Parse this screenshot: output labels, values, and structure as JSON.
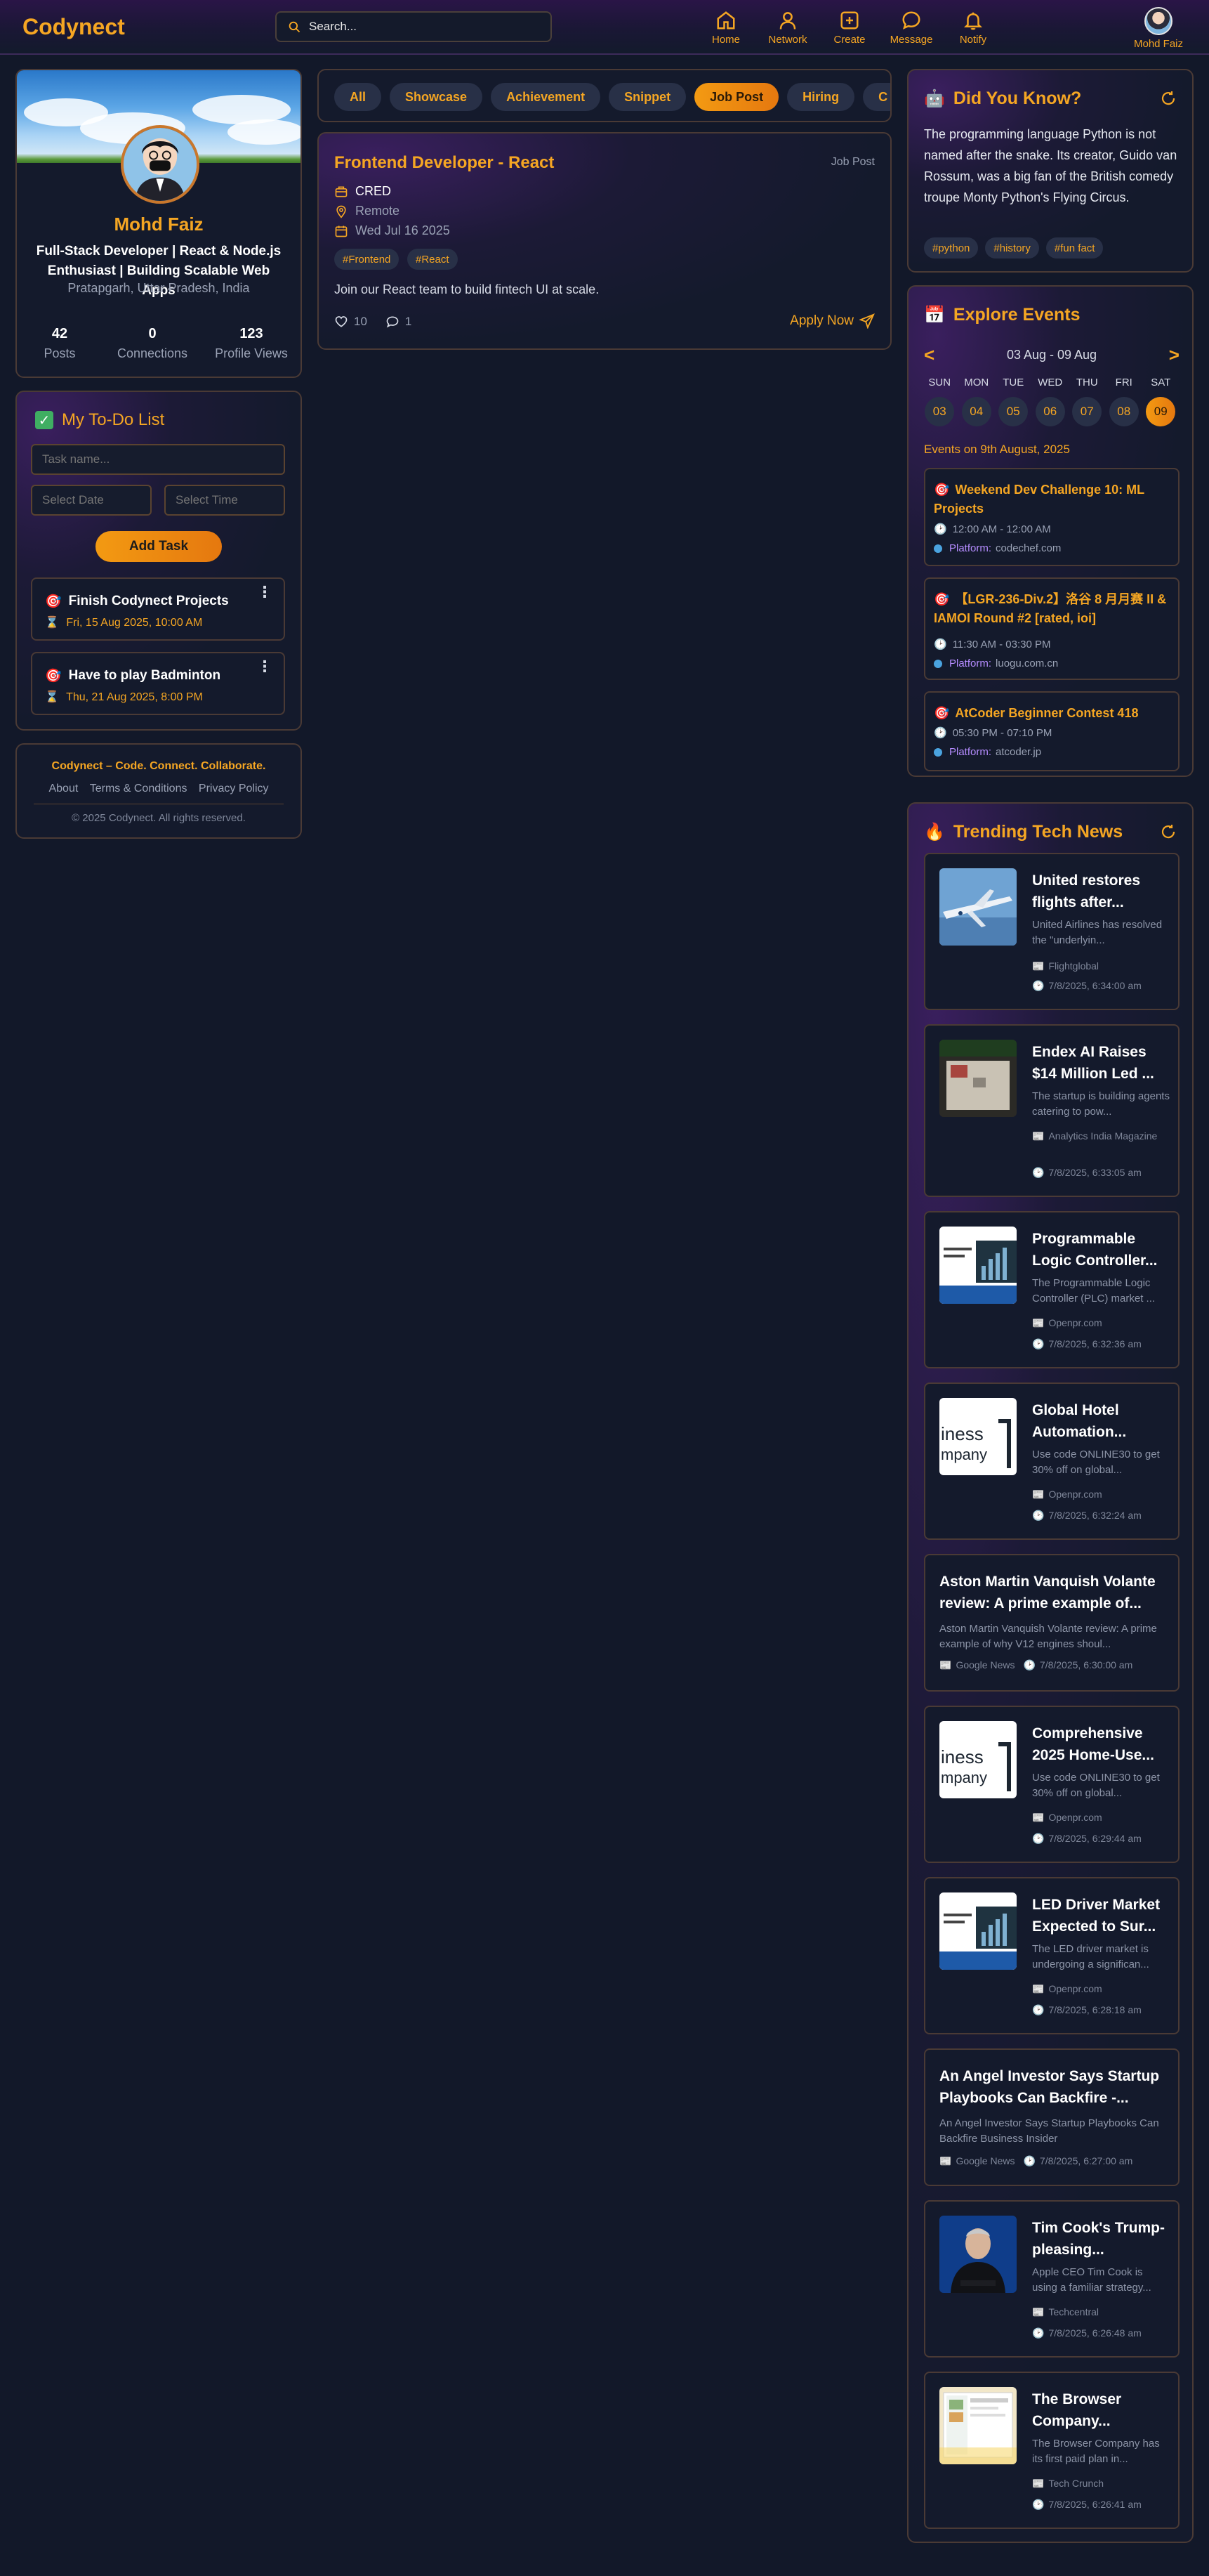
{
  "nav": {
    "brand": "Codynect",
    "search_placeholder": "Search...",
    "items": [
      {
        "label": "Home",
        "icon": "home-icon"
      },
      {
        "label": "Network",
        "icon": "user-icon"
      },
      {
        "label": "Create",
        "icon": "plus-square-icon"
      },
      {
        "label": "Message",
        "icon": "message-icon"
      },
      {
        "label": "Notify",
        "icon": "bell-icon"
      }
    ],
    "profile_label": "Mohd Faiz"
  },
  "profile": {
    "name": "Mohd Faiz",
    "bio": "Full-Stack Developer | React & Node.js Enthusiast | Building Scalable Web Apps",
    "location": "Pratapgarh, Uttar Pradesh, India",
    "stats": [
      {
        "value": "42",
        "label": "Posts"
      },
      {
        "value": "0",
        "label": "Connections"
      },
      {
        "value": "123",
        "label": "Profile Views"
      }
    ]
  },
  "todo": {
    "title": "My To-Do List",
    "task_placeholder": "Task name...",
    "date_placeholder": "Select Date",
    "time_placeholder": "Select Time",
    "add_label": "Add Task",
    "tasks": [
      {
        "title": "Finish Codynect Projects",
        "due": "Fri, 15 Aug 2025, 10:00 AM"
      },
      {
        "title": "Have to play Badminton",
        "due": "Thu, 21 Aug 2025, 8:00 PM"
      }
    ]
  },
  "footer": {
    "tagline": "Codynect – Code. Connect. Collaborate.",
    "links": [
      "About",
      "Terms & Conditions",
      "Privacy Policy"
    ],
    "copyright": "© 2025 Codynect. All rights reserved."
  },
  "filters": {
    "chips": [
      "All",
      "Showcase",
      "Achievement",
      "Snippet",
      "Job Post",
      "Hiring",
      "C"
    ],
    "active": "Job Post"
  },
  "post": {
    "title": "Frontend Developer - React",
    "type": "Job Post",
    "company": "CRED",
    "location": "Remote",
    "date": "Wed Jul 16 2025",
    "tags": [
      "#Frontend",
      "#React"
    ],
    "body": "Join our React team to build fintech UI at scale.",
    "likes": "10",
    "comments": "1",
    "apply_label": "Apply Now"
  },
  "dyk": {
    "title": "Did You Know?",
    "text": "The programming language Python is not named after the snake. Its creator, Guido van Rossum, was a big fan of the British comedy troupe Monty Python's Flying Circus.",
    "tags": [
      "#python",
      "#history",
      "#fun fact"
    ]
  },
  "events": {
    "title": "Explore Events",
    "prev": "<",
    "next": ">",
    "range": "03 Aug - 09 Aug",
    "days": [
      {
        "name": "SUN",
        "date": "03"
      },
      {
        "name": "MON",
        "date": "04"
      },
      {
        "name": "TUE",
        "date": "05"
      },
      {
        "name": "WED",
        "date": "06"
      },
      {
        "name": "THU",
        "date": "07"
      },
      {
        "name": "FRI",
        "date": "08"
      },
      {
        "name": "SAT",
        "date": "09"
      }
    ],
    "selected": "09",
    "heading": "Events on 9th August, 2025",
    "platform_label": "Platform:",
    "list": [
      {
        "title": "Weekend Dev Challenge 10: ML Projects",
        "time": "12:00 AM - 12:00 AM",
        "platform": "codechef.com"
      },
      {
        "title": "【LGR-236-Div.2】洛谷 8 月月赛 II & IAMOI Round #2 [rated, ioi]",
        "time": "11:30 AM - 03:30 PM",
        "platform": "luogu.com.cn"
      },
      {
        "title": "AtCoder Beginner Contest 418",
        "time": "05:30 PM - 07:10 PM",
        "platform": "atcoder.jp"
      }
    ]
  },
  "news": {
    "title": "Trending Tech News",
    "items": [
      {
        "title": "United restores flights after...",
        "desc": "United Airlines has resolved the \"underlyin...",
        "source": "Flightglobal",
        "time": "7/8/2025, 6:34:00 am",
        "thumb": "plane"
      },
      {
        "title": "Endex AI Raises $14 Million Led ...",
        "desc": "The startup is building agents catering to pow...",
        "source": "Analytics India Magazine",
        "time": "7/8/2025, 6:33:05 am",
        "thumb": "wall"
      },
      {
        "title": "Programmable Logic Controller...",
        "desc": "The Programmable Logic Controller (PLC) market ...",
        "source": "Openpr.com",
        "time": "7/8/2025, 6:32:36 am",
        "thumb": "market"
      },
      {
        "title": "Global Hotel Automation...",
        "desc": "Use code ONLINE30 to get 30% off on global...",
        "source": "Openpr.com",
        "time": "7/8/2025, 6:32:24 am",
        "thumb": "business"
      },
      {
        "title": "Aston Martin Vanquish Volante review: A prime example of...",
        "desc": "Aston Martin Vanquish Volante review: A prime example of why V12 engines shoul...",
        "source": "Google News",
        "time": "7/8/2025, 6:30:00 am",
        "thumb": ""
      },
      {
        "title": "Comprehensive 2025 Home-Use...",
        "desc": "Use code ONLINE30 to get 30% off on global...",
        "source": "Openpr.com",
        "time": "7/8/2025, 6:29:44 am",
        "thumb": "business"
      },
      {
        "title": "LED Driver Market Expected to Sur...",
        "desc": "The LED driver market is undergoing a significan...",
        "source": "Openpr.com",
        "time": "7/8/2025, 6:28:18 am",
        "thumb": "market"
      },
      {
        "title": "An Angel Investor Says Startup Playbooks Can Backfire -...",
        "desc": "An Angel Investor Says Startup Playbooks Can Backfire Business Insider",
        "source": "Google News",
        "time": "7/8/2025, 6:27:00 am",
        "thumb": ""
      },
      {
        "title": "Tim Cook's Trump-pleasing...",
        "desc": "Apple CEO Tim Cook is using a familiar strategy...",
        "source": "Techcentral",
        "time": "7/8/2025, 6:26:48 am",
        "thumb": "person"
      },
      {
        "title": "The Browser Company...",
        "desc": "The Browser Company has its first paid plan in...",
        "source": "Tech Crunch",
        "time": "7/8/2025, 6:26:41 am",
        "thumb": "browser"
      }
    ]
  },
  "colors": {
    "accent": "#f5a623",
    "background": "#121829",
    "card_border": "#4a3a35",
    "chip_bg": "#283047"
  }
}
